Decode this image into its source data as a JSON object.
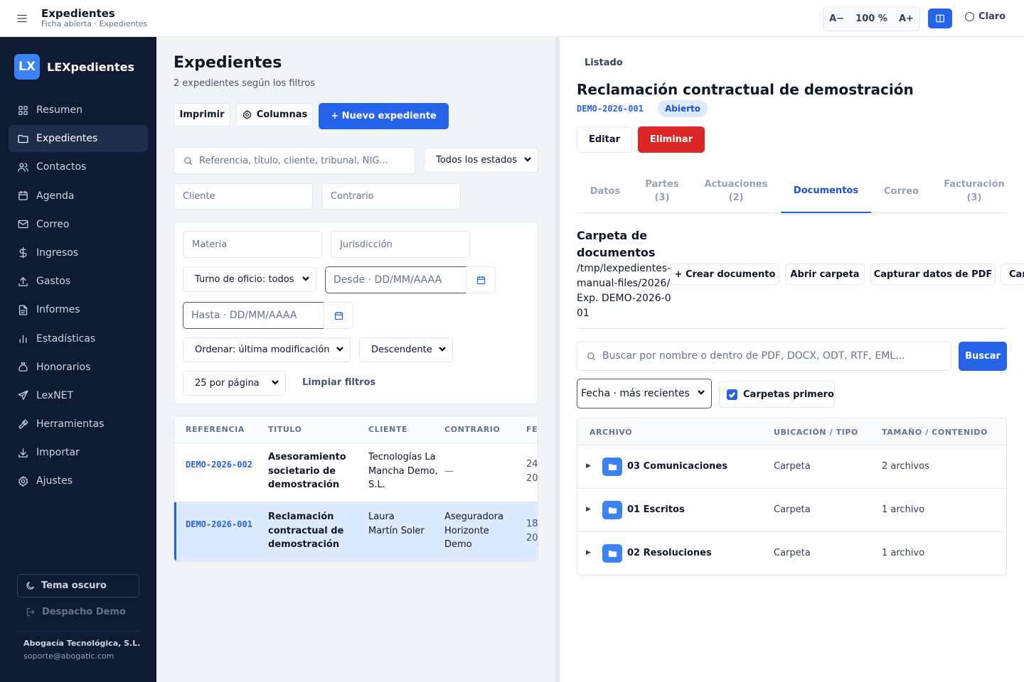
{
  "topbar": {
    "title": "Expedientes",
    "subtitle": "Ficha abierta · Expedientes",
    "font_decrease": "A−",
    "zoom_level": "100 %",
    "font_increase": "A+",
    "theme_label": "Claro"
  },
  "sidebar": {
    "logo_text": "LX",
    "app_name": "LEXpedientes",
    "items": [
      {
        "label": "Resumen",
        "icon": "grid-icon"
      },
      {
        "label": "Expedientes",
        "icon": "folder-icon",
        "active": true
      },
      {
        "label": "Contactos",
        "icon": "users-icon"
      },
      {
        "label": "Agenda",
        "icon": "calendar-icon"
      },
      {
        "label": "Correo",
        "icon": "mail-icon"
      },
      {
        "label": "Ingresos",
        "icon": "dollar-icon"
      },
      {
        "label": "Gastos",
        "icon": "upload-icon"
      },
      {
        "label": "Informes",
        "icon": "document-icon"
      },
      {
        "label": "Estadísticas",
        "icon": "bar-chart-icon"
      },
      {
        "label": "Honorarios",
        "icon": "bag-icon"
      },
      {
        "label": "LexNET",
        "icon": "send-icon"
      },
      {
        "label": "Herramientas",
        "icon": "hammer-icon"
      },
      {
        "label": "Importar",
        "icon": "download-icon"
      },
      {
        "label": "Ajustes",
        "icon": "gear-icon"
      }
    ],
    "dark_theme_label": "Tema oscuro",
    "logout_label": "Despacho Demo",
    "company": "Abogacía Tecnológica, S.L.",
    "email": "soporte@abogatic.com"
  },
  "list": {
    "heading": "Expedientes",
    "count_text": "2 expedientes según los filtros",
    "print_label": "Imprimir",
    "columns_label": "Columnas",
    "new_label": "+ Nuevo expediente",
    "search_placeholder": "Referencia, título, cliente, tribunal, NIG...",
    "status_select": "Todos los estados",
    "client_placeholder": "Cliente",
    "opponent_placeholder": "Contrario",
    "subject_placeholder": "Materia",
    "jurisdiction_placeholder": "Jurisdicción",
    "duty_select": "Turno de oficio: todos",
    "from_placeholder": "Desde · DD/MM/AAAA",
    "to_placeholder": "Hasta · DD/MM/AAAA",
    "order_select": "Ordenar: última modificación",
    "direction_select": "Descendente",
    "per_page_select": "25 por página",
    "clear_label": "Limpiar filtros",
    "columns": [
      "REFERENCIA",
      "TITULO",
      "CLIENTE",
      "CONTRARIO",
      "FE"
    ],
    "rows": [
      {
        "ref": "DEMO-2026-002",
        "title": "Asesoramiento societario de demostración",
        "client": "Tecnologías La Mancha Demo, S.L.",
        "opponent": "—",
        "date": "24 20",
        "selected": false
      },
      {
        "ref": "DEMO-2026-001",
        "title": "Reclamación contractual de demostración",
        "client": "Laura Martín Soler",
        "opponent": "Aseguradora Horizonte Demo",
        "date": "18 20",
        "selected": true
      }
    ]
  },
  "detail": {
    "back_label": "Listado",
    "title": "Reclamación contractual de demostración",
    "ref": "DEMO-2026-001",
    "status": "Abierto",
    "edit_label": "Editar",
    "delete_label": "Eliminar",
    "tabs": [
      {
        "label": "Datos",
        "count": ""
      },
      {
        "label": "Partes",
        "count": "(3)"
      },
      {
        "label": "Actuaciones",
        "count": "(2)"
      },
      {
        "label": "Documentos",
        "count": "",
        "active": true
      },
      {
        "label": "Correo",
        "count": ""
      },
      {
        "label": "Facturación",
        "count": "(3)"
      }
    ],
    "folder_heading": "Carpeta de documentos",
    "folder_path": "/tmp/lexpedientes-manual-files/2026/Exp. DEMO-2026-001",
    "create_doc_label": "+ Crear documento",
    "open_folder_label": "Abrir carpeta",
    "capture_pdf_label": "Capturar datos de PDF",
    "more_label": "Car",
    "doc_search_placeholder": "Buscar por nombre o dentro de PDF, DOCX, ODT, RTF, EML...",
    "search_button": "Buscar",
    "sort_select": "Fecha · más recientes",
    "folders_first_label": "Carpetas primero",
    "folders_first_checked": true,
    "file_columns": [
      "ARCHIVO",
      "UBICACIÓN / TIPO",
      "TAMAÑO / CONTENIDO"
    ],
    "files": [
      {
        "name": "03 Comunicaciones",
        "type": "Carpeta",
        "size": "2 archivos"
      },
      {
        "name": "01 Escritos",
        "type": "Carpeta",
        "size": "1 archivo"
      },
      {
        "name": "02 Resoluciones",
        "type": "Carpeta",
        "size": "1 archivo"
      }
    ]
  },
  "colors": {
    "accent": "#2563eb",
    "sidebar_bg": "#0f1b33",
    "danger": "#dc2626",
    "selected_row": "#dbeafe"
  }
}
